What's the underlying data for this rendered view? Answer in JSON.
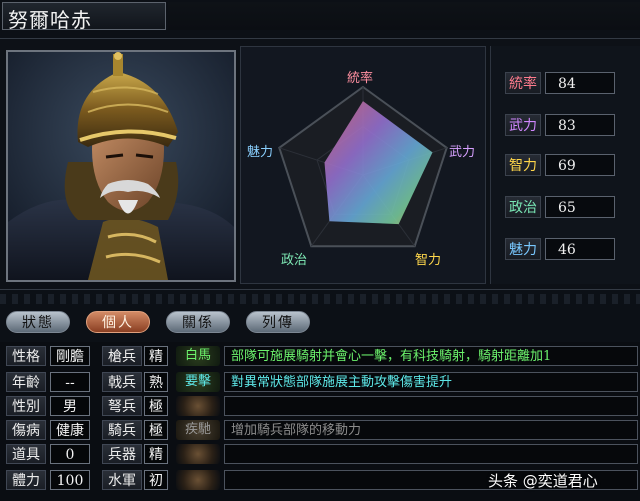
{
  "officer_name": "努爾哈赤",
  "radar": {
    "labels": {
      "top": "統率",
      "right": "武力",
      "bottom_right": "智力",
      "bottom_left": "政治",
      "left": "魅力"
    }
  },
  "stats": [
    {
      "label": "統率",
      "value": "84",
      "color": "#ff7b8d",
      "level": 84
    },
    {
      "label": "武力",
      "value": "83",
      "color": "#d187ff",
      "level": 83
    },
    {
      "label": "智力",
      "value": "69",
      "color": "#ffd64a",
      "level": 69
    },
    {
      "label": "政治",
      "value": "65",
      "color": "#79e6b4",
      "level": 65
    },
    {
      "label": "魅力",
      "value": "46",
      "color": "#79c8ff",
      "level": 46
    }
  ],
  "tabs": [
    "狀態",
    "個人",
    "關係",
    "列傳"
  ],
  "active_tab": 1,
  "personal": [
    {
      "label": "性格",
      "value": "剛膽"
    },
    {
      "label": "年齡",
      "value": "--"
    },
    {
      "label": "性別",
      "value": "男"
    },
    {
      "label": "傷病",
      "value": "健康"
    },
    {
      "label": "道具",
      "value": "0"
    },
    {
      "label": "體力",
      "value": "100"
    }
  ],
  "aptitudes": [
    {
      "label": "槍兵",
      "value": "精"
    },
    {
      "label": "戟兵",
      "value": "熟"
    },
    {
      "label": "弩兵",
      "value": "極"
    },
    {
      "label": "騎兵",
      "value": "極"
    },
    {
      "label": "兵器",
      "value": "精"
    },
    {
      "label": "水軍",
      "value": "初"
    }
  ],
  "skills": [
    {
      "name": "白馬",
      "desc": "部隊可施展騎射并會心一擊，有科技騎射，騎射距離加1",
      "color": "#6cf26c",
      "active": true
    },
    {
      "name": "要擊",
      "desc": "對異常狀態部隊施展主動攻擊傷害提升",
      "color": "#5ee8e8",
      "active": true
    },
    {
      "name": "",
      "desc": "",
      "color": "#888888",
      "active": false
    },
    {
      "name": "疾馳",
      "desc": "增加騎兵部隊的移動力",
      "color": "#8a8a8a",
      "active": false
    },
    {
      "name": "",
      "desc": "",
      "color": "#888888",
      "active": false
    },
    {
      "name": "",
      "desc": "",
      "color": "#888888",
      "active": false
    }
  ],
  "watermark": "头条 @奕道君心"
}
